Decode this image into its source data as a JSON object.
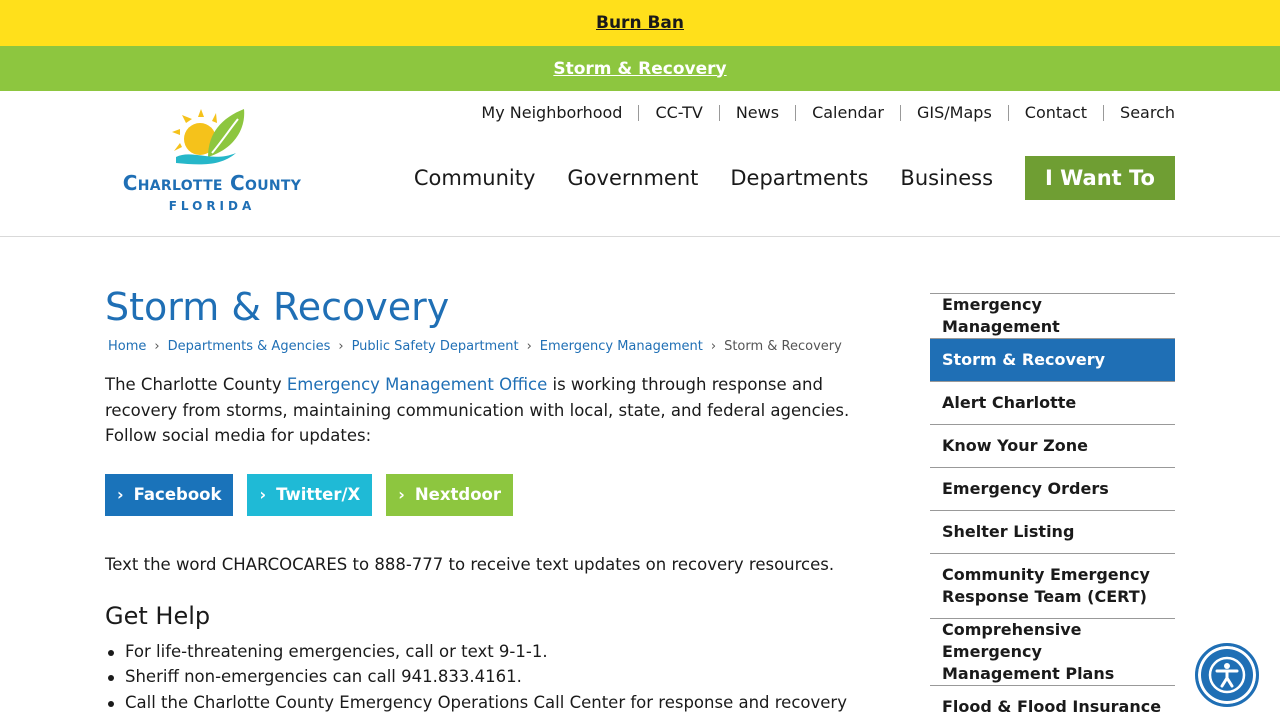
{
  "alerts": {
    "burn_ban": "Burn Ban",
    "storm": "Storm & Recovery"
  },
  "header": {
    "logo": {
      "name": "Charlotte County",
      "state": "FLORIDA"
    },
    "utility_links": [
      "My Neighborhood",
      "CC-TV",
      "News",
      "Calendar",
      "GIS/Maps",
      "Contact",
      "Search"
    ],
    "main_nav": [
      "Community",
      "Government",
      "Departments",
      "Business"
    ],
    "i_want_to": "I Want To"
  },
  "page": {
    "title": "Storm & Recovery",
    "breadcrumb": [
      "Home",
      "Departments & Agencies",
      "Public Safety Department",
      "Emergency Management"
    ],
    "breadcrumb_current": "Storm & Recovery",
    "intro_before": "The Charlotte County ",
    "intro_link": "Emergency Management Office",
    "intro_after": " is working through response and recovery from storms, maintaining communication with local, state, and federal agencies. Follow social media for updates:",
    "social_buttons": [
      "Facebook",
      "Twitter/X",
      "Nextdoor"
    ],
    "text_updates": "Text the word CHARCOCARES to 888-777 to receive text updates on recovery resources.",
    "get_help_heading": "Get Help",
    "help_items": [
      "For life-threatening emergencies, call or text 9-1-1.",
      "Sheriff non-emergencies can call 941.833.4161.",
      "Call the Charlotte County Emergency Operations Call Center for response and recovery"
    ]
  },
  "sidenav": {
    "items": [
      "Emergency Management",
      "Storm & Recovery",
      "Alert Charlotte",
      "Know Your Zone",
      "Emergency Orders",
      "Shelter Listing",
      "Community Emergency Response Team (CERT)",
      "Comprehensive Emergency Management Plans",
      "Flood & Flood Insurance Information"
    ],
    "active_index": 1
  },
  "colors": {
    "yellow_bar": "#ffe01b",
    "green_bar": "#8dc63f",
    "brand_blue": "#1f6fb5",
    "i_want_green": "#6f9e33",
    "facebook_blue": "#1a73ba",
    "twitter_cyan": "#1fbad6",
    "nextdoor_green": "#8dc63f"
  },
  "icons": {
    "accessibility": "accessibility-icon",
    "chevron": "chevron-right-icon"
  }
}
